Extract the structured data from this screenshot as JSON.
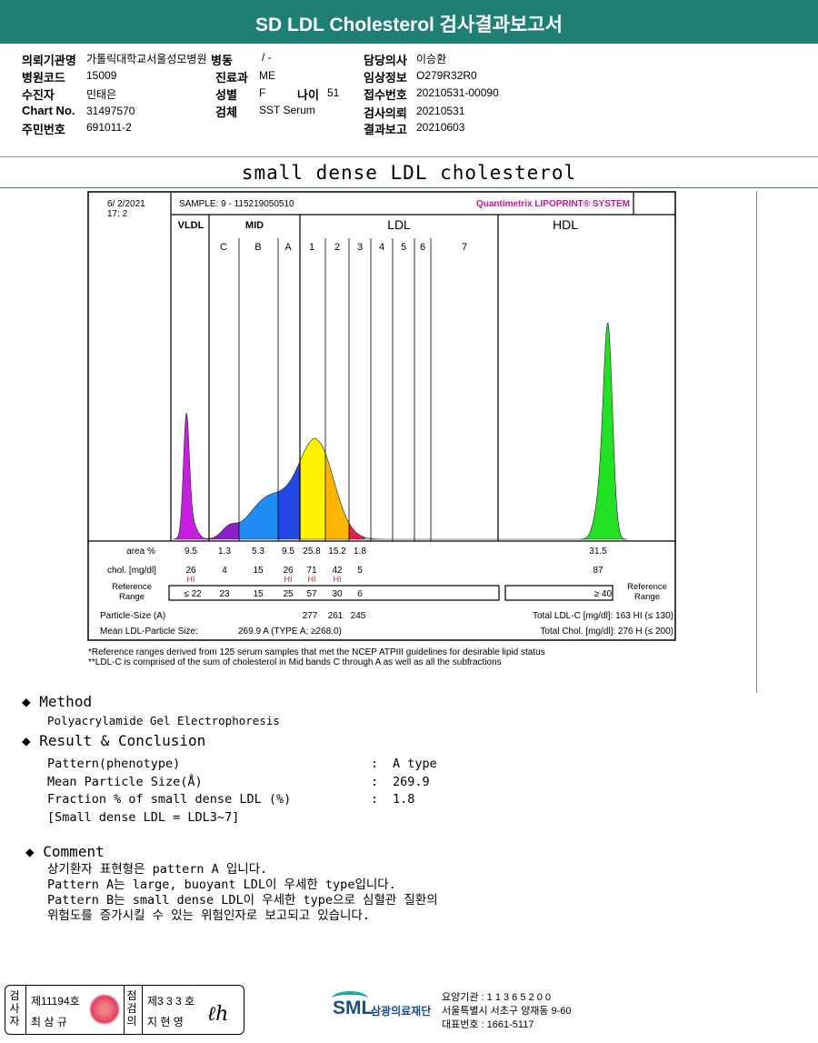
{
  "title": "SD LDL Cholesterol 검사결과보고서",
  "info": {
    "hospital_label": "의뢰기관명",
    "hospital": "가톨릭대학교서울성모병원",
    "ward_label": "병동",
    "ward": "/ -",
    "doctor_label": "담당의사",
    "doctor": "이승환",
    "code_label": "병원코드",
    "code": "15009",
    "dept_label": "진료과",
    "dept": "ME",
    "clinical_label": "임상정보",
    "clinical": "O279R32R0",
    "patient_label": "수진자",
    "patient": "민태은",
    "sex_label": "성별",
    "sex": "F",
    "age_label": "나이",
    "age": "51",
    "receipt_label": "접수번호",
    "receipt": "20210531-00090",
    "chart_label": "Chart No.",
    "chart": "31497570",
    "specimen_label": "검체",
    "specimen": "SST Serum",
    "request_label": "검사의뢰",
    "request": "20210531",
    "id_label": "주민번호",
    "id": "691011-2",
    "report_label": "결과보고",
    "report": "20210603"
  },
  "subtitle": "small dense LDL cholesterol",
  "printout": {
    "date": "6/  2/2021",
    "time": "17:  2",
    "sample": "SAMPLE:    9 - 115219050510",
    "brand": "Quantimetrix LIPOPRINT® SYSTEM",
    "groups": [
      "VLDL",
      "MID",
      "LDL",
      "HDL"
    ],
    "bands": [
      "C",
      "B",
      "A",
      "1",
      "2",
      "3",
      "4",
      "5",
      "6",
      "7"
    ],
    "row_labels": {
      "area": "area %",
      "chol": "chol. [mg/dl]",
      "ref": "Reference Range",
      "ref_right": "Reference Range",
      "particle": "Particle-Size (A)",
      "mean": "Mean LDL-Particle Size:"
    },
    "mean_value": "269.9 A    (TYPE A; ≥268.0)",
    "total_ldl": "Total LDL-C [mg/dl]:   163   HI (≤ 130)",
    "total_chol": "Total Chol. [mg/dl]:    276   H (≤ 200)",
    "footnote1": "*Reference ranges derived from 125 serum samples that met the NCEP ATPIII guidelines for desirable lipid status",
    "footnote2": "**LDL-C is comprised of the sum of cholesterol in Mid bands C through A as well as all the subfractions"
  },
  "chart_data": {
    "type": "table",
    "columns": [
      "VLDL",
      "C",
      "B",
      "A",
      "1",
      "2",
      "3",
      "HDL"
    ],
    "area_pct": [
      "9.5",
      "1.3",
      "5.3",
      "9.5",
      "25.8",
      "15.2",
      "1.8",
      "31.5"
    ],
    "chol": [
      "26",
      "4",
      "15",
      "26",
      "71",
      "42",
      "5",
      "87"
    ],
    "flags": [
      "HI",
      "",
      "",
      "HI",
      "HI",
      "HI",
      "",
      ""
    ],
    "reference": [
      "≤ 22",
      "23",
      "15",
      "25",
      "57",
      "30",
      "6",
      "≥ 40"
    ],
    "particle_size": {
      "1": "277",
      "2": "261",
      "3": "245"
    },
    "colors": {
      "VLDL": "#c81ee0",
      "C": "#8a22c8",
      "B": "#1e8cf0",
      "A": "#2248e6",
      "1": "#fff200",
      "2": "#ffb400",
      "3": "#e8204a",
      "HDL": "#22e022"
    }
  },
  "method": {
    "heading": "Method",
    "text": "Polyacrylamide Gel Electrophoresis"
  },
  "result": {
    "heading": "Result & Conclusion",
    "rows": [
      [
        "Pattern(phenotype)",
        ":",
        "A type"
      ],
      [
        "Mean Particle Size(Å)",
        ":",
        "269.9"
      ],
      [
        "Fraction % of small dense LDL (%)",
        ":",
        "1.8"
      ]
    ],
    "note": "[Small dense LDL = LDL3~7]"
  },
  "comment": {
    "heading": "Comment",
    "lines": [
      "상기환자 표현형은 pattern A 입니다.",
      "Pattern A는 large, buoyant LDL이 우세한 type입니다.",
      "Pattern B는 small dense LDL이 우세한 type으로 심혈관 질환의",
      "위험도를 증가시킬 수 있는 위험인자로 보고되고 있습니다."
    ]
  },
  "footer": {
    "examiner_label": "검사자",
    "examiner_no": "제11194호",
    "examiner": "최 삼 규",
    "checker_label": "점검의",
    "checker_no": "제3 3 3 호",
    "checker": "지 현 영",
    "logo": "SML",
    "org": "삼광의료재단",
    "line1": "요양기관 : 1 1 3 6 5 2 0 0",
    "line2": "서울특별시 서초구 양재동 9-60",
    "line3": "대표번호 : 1661-5117"
  }
}
